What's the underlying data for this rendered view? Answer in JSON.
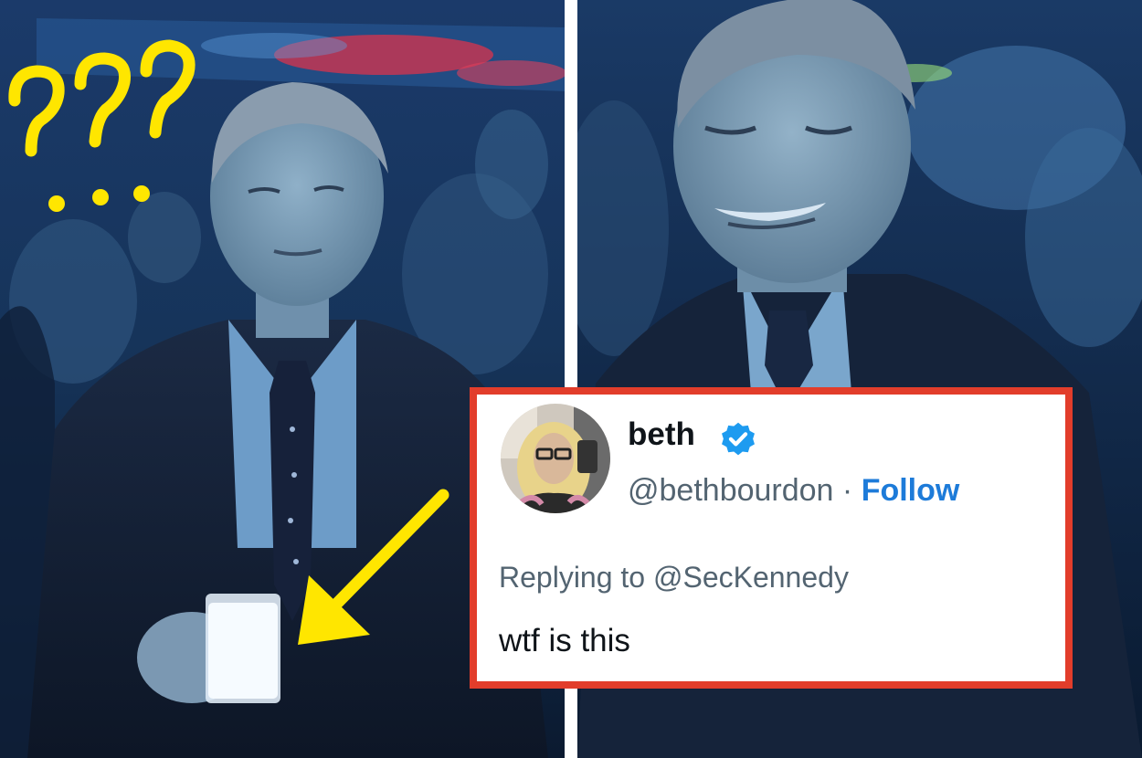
{
  "tweet": {
    "display_name": "beth",
    "handle": "@bethbourdon",
    "separator": " · ",
    "follow_label": "Follow",
    "replying_prefix": "Replying to ",
    "replying_to": "@SecKennedy",
    "text": "wtf is this"
  },
  "colors": {
    "tweet_border": "#e23d2b",
    "follow_blue": "#1d7bd9",
    "verified_blue": "#1d9bf0",
    "annotation_yellow": "#ffe600",
    "muted_text": "#536471"
  },
  "icons": [
    "verified-badge-icon",
    "question-marks-doodle",
    "yellow-arrow"
  ]
}
